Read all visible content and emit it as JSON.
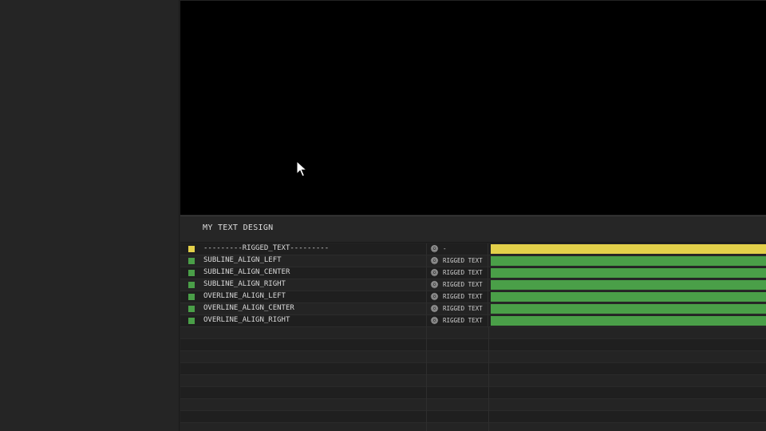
{
  "composition": {
    "title": "MY TEXT DESIGN"
  },
  "layers": [
    {
      "name": "---------RIGGED_TEXT---------",
      "parent": "-",
      "color": "#e3d04a",
      "icon": "spiral-icon"
    },
    {
      "name": "SUBLINE_ALIGN_LEFT",
      "parent": "RIGGED TEXT",
      "color": "#4a9f48",
      "icon": "spiral-icon"
    },
    {
      "name": "SUBLINE_ALIGN_CENTER",
      "parent": "RIGGED TEXT",
      "color": "#4a9f48",
      "icon": "spiral-icon"
    },
    {
      "name": "SUBLINE_ALIGN_RIGHT",
      "parent": "RIGGED TEXT",
      "color": "#4a9f48",
      "icon": "spiral-icon"
    },
    {
      "name": "OVERLINE_ALIGN_LEFT",
      "parent": "RIGGED TEXT",
      "color": "#4a9f48",
      "icon": "spiral-icon"
    },
    {
      "name": "OVERLINE_ALIGN_CENTER",
      "parent": "RIGGED TEXT",
      "color": "#4a9f48",
      "icon": "spiral-icon"
    },
    {
      "name": "OVERLINE_ALIGN_RIGHT",
      "parent": "RIGGED TEXT",
      "color": "#4a9f48",
      "icon": "spiral-icon"
    }
  ],
  "viewer": {
    "cursor_icon": "arrow-cursor-icon"
  }
}
